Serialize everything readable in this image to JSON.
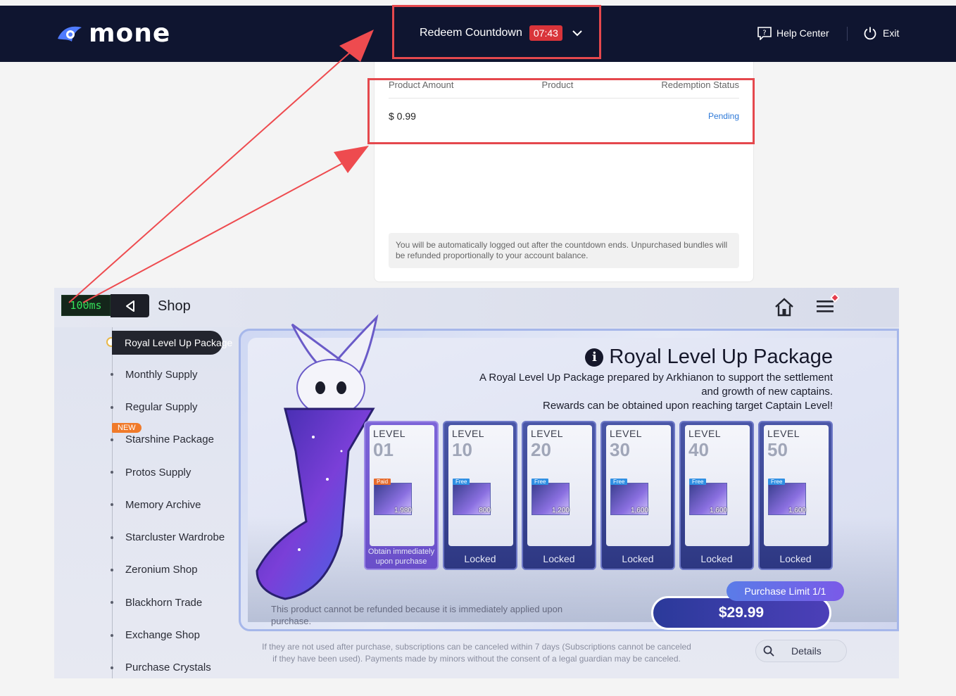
{
  "topbar": {
    "logo_text": "mone",
    "redeem_label": "Redeem Countdown",
    "redeem_time": "07:43",
    "help_label": "Help Center",
    "exit_label": "Exit"
  },
  "panel": {
    "columns": [
      "Product Amount",
      "Product",
      "Redemption Status"
    ],
    "row": {
      "amount": "$ 0.99",
      "status": "Pending"
    },
    "notice": "You will be automatically logged out after the countdown ends. Unpurchased bundles will be refunded proportionally to your account balance."
  },
  "game": {
    "latency": "100ms",
    "title": "Shop",
    "sidebar": [
      "Royal Level Up Package",
      "Monthly Supply",
      "Regular Supply",
      "Starshine Package",
      "Protos Supply",
      "Memory Archive",
      "Starcluster Wardrobe",
      "Zeronium Shop",
      "Blackhorn Trade",
      "Exchange Shop",
      "Purchase Crystals"
    ],
    "new_tag": "NEW",
    "package": {
      "title": "Royal Level Up Package",
      "desc_line1": "A Royal Level Up Package prepared by Arkhianon to support the settlement",
      "desc_line2": "and growth of new captains.",
      "desc_line3": "Rewards can be obtained upon reaching target Captain Level!"
    },
    "level_label": "LEVEL",
    "cards": [
      {
        "level": "01",
        "tag": "Paid",
        "qty": "1,980",
        "status": "Obtain immediately upon purchase"
      },
      {
        "level": "10",
        "tag": "Free",
        "qty": "800",
        "status": "Locked"
      },
      {
        "level": "20",
        "tag": "Free",
        "qty": "1,200",
        "status": "Locked"
      },
      {
        "level": "30",
        "tag": "Free",
        "qty": "1,600",
        "status": "Locked"
      },
      {
        "level": "40",
        "tag": "Free",
        "qty": "1,600",
        "status": "Locked"
      },
      {
        "level": "50",
        "tag": "Free",
        "qty": "1,600",
        "status": "Locked"
      }
    ],
    "purchase_limit": "Purchase Limit 1/1",
    "price": "$29.99",
    "refund_note": "This product cannot be refunded because it is immediately applied upon purchase.",
    "footer_note_1": "If they are not used after purchase, subscriptions can be canceled within 7 days (Subscriptions cannot be canceled",
    "footer_note_2": "if they have been used). Payments made by minors without the consent of a legal guardian may be canceled.",
    "details_label": "Details"
  },
  "colors": {
    "topbar_bg": "#0f1530",
    "highlight_red": "#e5484d",
    "pending_blue": "#2f7ad8",
    "latency_green": "#35e05a"
  }
}
